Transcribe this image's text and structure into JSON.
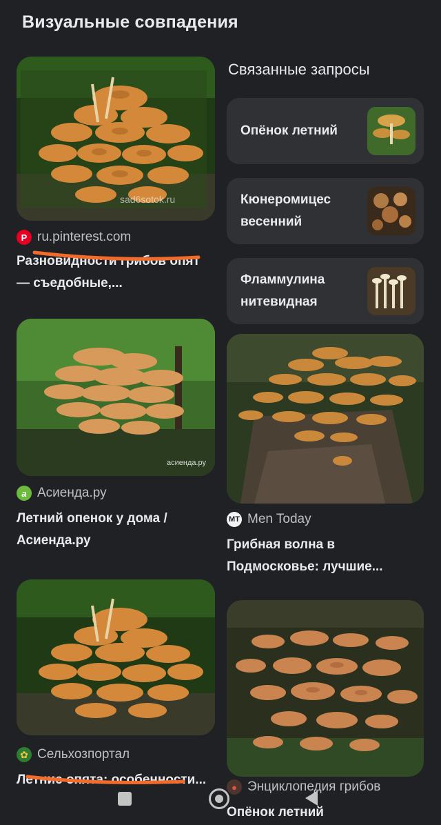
{
  "header": {
    "title": "Визуальные совпадения"
  },
  "related": {
    "heading": "Связанные запросы",
    "items": [
      {
        "label": "Опёнок летний"
      },
      {
        "label": "Кюнеромицес весенний"
      },
      {
        "label": "Фламмулина нитевидная"
      }
    ]
  },
  "results": {
    "r1": {
      "source": "ru.pinterest.com",
      "title": "Разновидности грибов опят — съедобные,...",
      "watermark": "sad6sotok.ru"
    },
    "r2": {
      "source": "Асиенда.ру",
      "title": "Летний опенок у дома / Асиенда.ру",
      "watermark": "асиенда.ру"
    },
    "r3": {
      "source": "Men Today",
      "title": "Грибная волна в Подмосковье: лучшие..."
    },
    "r4": {
      "source": "Сельхозпортал",
      "title": "Летние опята: особенности..."
    },
    "r5": {
      "source": "Энциклопедия грибов",
      "title": "Опёнок летний"
    }
  },
  "colors": {
    "background": "#202124",
    "card": "#303134",
    "annotation_underline": "#f26b2a",
    "pinterest": "#e60023"
  },
  "icons": {
    "pinterest": "pinterest-icon",
    "asienda": "asienda-icon",
    "mentoday": "mentoday-icon",
    "selhoz": "selhozportal-icon",
    "encyclopedia": "mushroom-icon",
    "nav_recents": "square-icon",
    "nav_home": "circle-icon",
    "nav_back": "triangle-back-icon"
  }
}
